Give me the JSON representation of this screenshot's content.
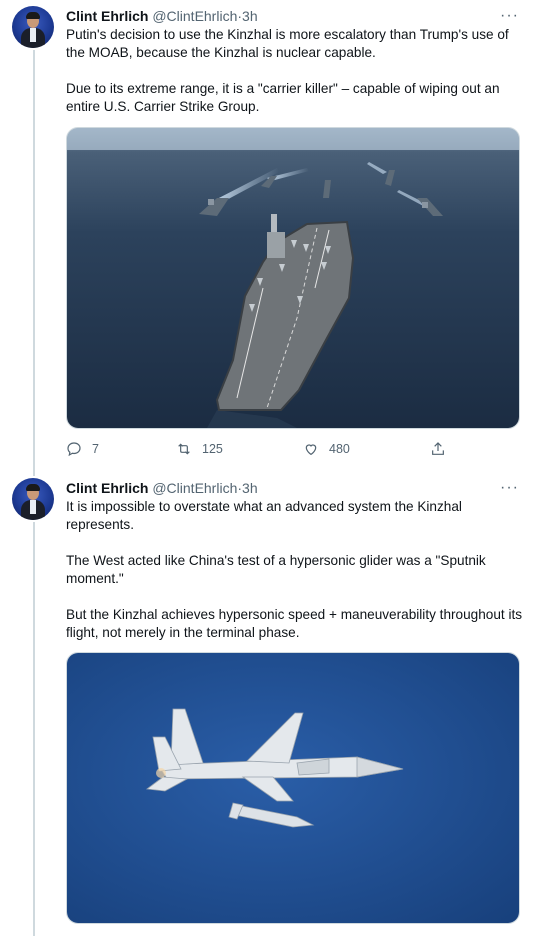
{
  "tweets": [
    {
      "name": "Clint Ehrlich",
      "handle": "@ClintEhrlich",
      "time": "3h",
      "more": "···",
      "paragraphs": [
        "Putin's decision to use the Kinzhal is more escalatory than Trump's use of the MOAB, because the Kinzhal is nuclear capable.",
        "Due to its extreme range, it is a \"carrier killer\" – capable of wiping out an entire U.S. Carrier Strike Group."
      ],
      "image_icon": "aircraft-carrier-strike-group-photo",
      "actions": {
        "reply_count": "7",
        "retweet_count": "125",
        "like_count": "480"
      }
    },
    {
      "name": "Clint Ehrlich",
      "handle": "@ClintEhrlich",
      "time": "3h",
      "more": "···",
      "paragraphs": [
        "It is impossible to overstate what an advanced system the Kinzhal represents.",
        "The West acted like China's test of a hypersonic glider was a \"Sputnik moment.\"",
        "But the Kinzhal achieves hypersonic speed + maneuverability throughout its flight, not merely in the terminal phase."
      ],
      "image_icon": "jet-with-kinzhal-missile-photo"
    }
  ],
  "separator": "·",
  "colors": {
    "text": "#0f1419",
    "secondary": "#536471",
    "thread_line": "#cfd9de",
    "sea": "#1f3a5a",
    "sky_blue": "#1d4d8f"
  }
}
